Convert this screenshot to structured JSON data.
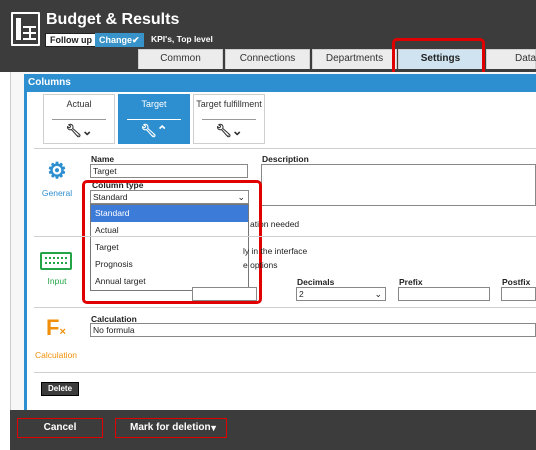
{
  "header": {
    "title": "Budget & Results",
    "followup_label": "Follow up",
    "change_label": "Change✔",
    "kpi_label": "KPI's, Top level"
  },
  "tabs": [
    {
      "label": "Common"
    },
    {
      "label": "Connections"
    },
    {
      "label": "Departments"
    },
    {
      "label": "Settings",
      "selected": true
    },
    {
      "label": "Data"
    }
  ],
  "columns": {
    "header": "Columns",
    "tabs": [
      {
        "label": "Actual"
      },
      {
        "label": "Target",
        "selected": true
      },
      {
        "label": "Target fulfillment"
      }
    ]
  },
  "general": {
    "label": "General",
    "name_label": "Name",
    "name_value": "Target",
    "description_label": "Description",
    "column_type_label": "Column type",
    "column_type_value": "Standard",
    "calc_needed_text": "ation needed",
    "options": [
      "Standard",
      "Actual",
      "Target",
      "Prognosis",
      "Annual target"
    ],
    "selected_option": "Standard"
  },
  "input": {
    "label": "Input",
    "interface_text": "ly in the interface",
    "options_text": "e options",
    "decimals_label": "Decimals",
    "decimals_value": "2",
    "prefix_label": "Prefix",
    "postfix_label": "Postfix"
  },
  "calculation": {
    "label": "Calculation",
    "field_label": "Calculation",
    "field_value": "No formula"
  },
  "actions": {
    "delete_label": "Delete",
    "cancel_label": "Cancel",
    "mark_label": "Mark for deletion"
  },
  "colors": {
    "accent": "#2d8fd0",
    "highlight": "#e00000",
    "header_bg": "#3c3c3c",
    "selected_option": "#3d7bd9"
  }
}
